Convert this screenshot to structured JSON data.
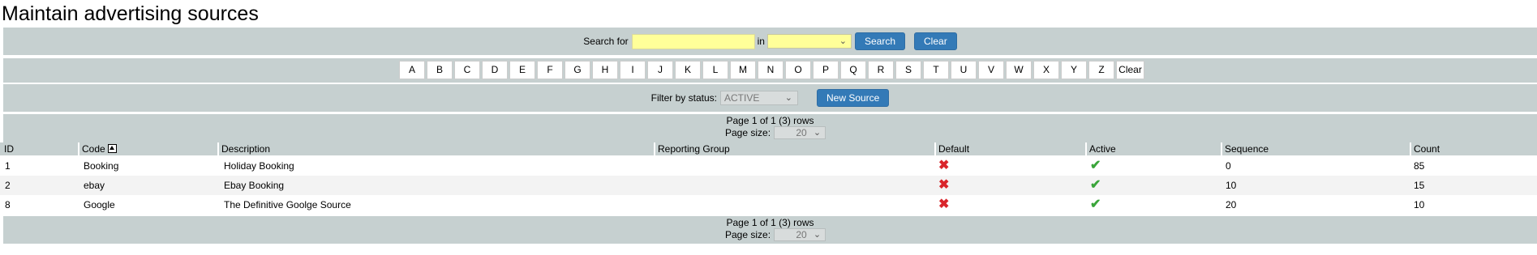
{
  "page": {
    "title": "Maintain advertising sources"
  },
  "search": {
    "label": "Search for",
    "value": "",
    "in_label": "in",
    "field_selected": "",
    "search_button": "Search",
    "clear_button": "Clear"
  },
  "alphabet": {
    "letters": [
      "A",
      "B",
      "C",
      "D",
      "E",
      "F",
      "G",
      "H",
      "I",
      "J",
      "K",
      "L",
      "M",
      "N",
      "O",
      "P",
      "Q",
      "R",
      "S",
      "T",
      "U",
      "V",
      "W",
      "X",
      "Y",
      "Z"
    ],
    "clear_label": "Clear"
  },
  "filter": {
    "label": "Filter by status:",
    "selected": "ACTIVE",
    "new_button": "New Source"
  },
  "pager": {
    "summary": "Page 1 of 1 (3) rows",
    "size_label": "Page size:",
    "size_value": "20"
  },
  "table": {
    "columns": [
      "ID",
      "Code",
      "Description",
      "Reporting Group",
      "Default",
      "Active",
      "Sequence",
      "Count"
    ],
    "rows": [
      {
        "id": "1",
        "code": "Booking",
        "description": "Holiday Booking",
        "reporting_group": "",
        "default": "no",
        "active": "yes",
        "sequence": "0",
        "count": "85"
      },
      {
        "id": "2",
        "code": "ebay",
        "description": "Ebay Booking",
        "reporting_group": "",
        "default": "no",
        "active": "yes",
        "sequence": "10",
        "count": "15"
      },
      {
        "id": "8",
        "code": "Google",
        "description": "The Definitive Goolge Source",
        "reporting_group": "",
        "default": "no",
        "active": "yes",
        "sequence": "20",
        "count": "10"
      }
    ]
  },
  "icons": {
    "sort": "sort-ascending-icon",
    "false": "cross-icon",
    "true": "check-icon",
    "dropdown": "chevron-down-icon"
  },
  "colors": {
    "band": "#c6d0d0",
    "button": "#337ab7",
    "input_highlight": "#ffff99",
    "cross": "#d9252b",
    "check": "#3aa53a"
  }
}
